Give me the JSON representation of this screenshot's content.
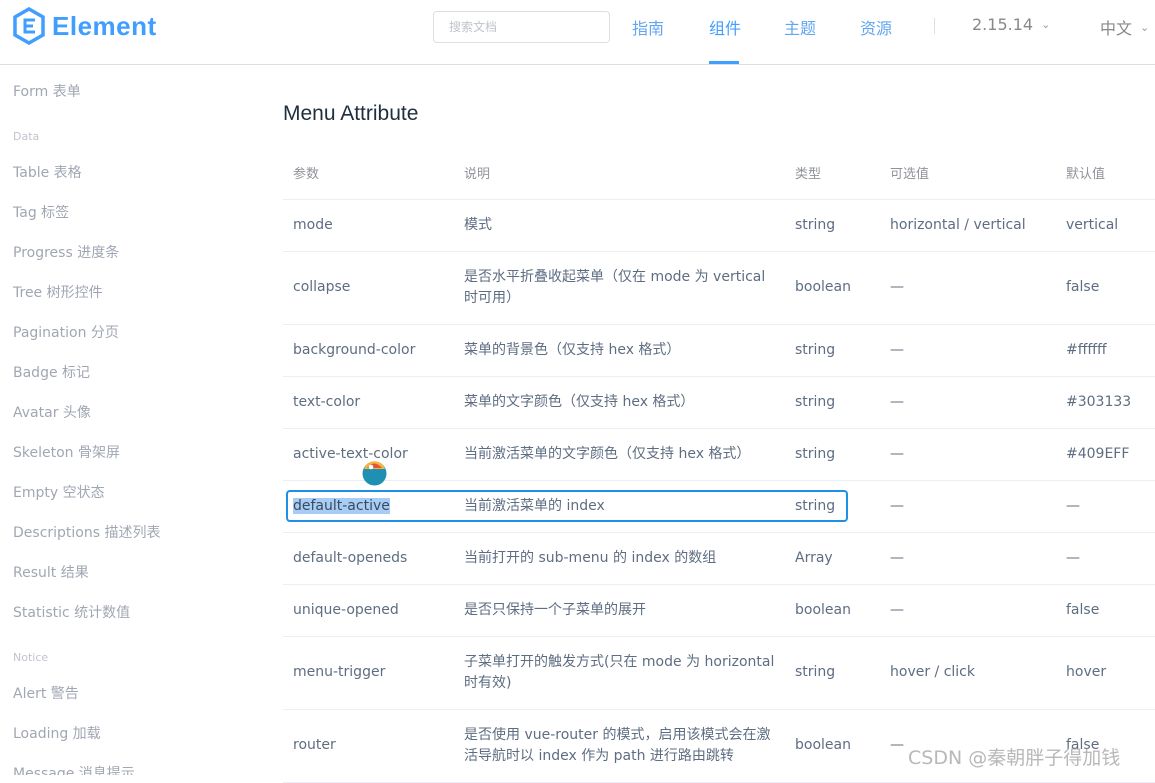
{
  "header": {
    "logo_text": "Element",
    "search_placeholder": "搜索文档",
    "nav": [
      {
        "label": "指南"
      },
      {
        "label": "组件"
      },
      {
        "label": "主题"
      },
      {
        "label": "资源"
      }
    ],
    "version": "2.15.14",
    "language": "中文"
  },
  "sidebar": {
    "items_top": [
      {
        "label": "Form 表单"
      }
    ],
    "group_data": "Data",
    "items_data": [
      {
        "label": "Table 表格"
      },
      {
        "label": "Tag 标签"
      },
      {
        "label": "Progress 进度条"
      },
      {
        "label": "Tree 树形控件"
      },
      {
        "label": "Pagination 分页"
      },
      {
        "label": "Badge 标记"
      },
      {
        "label": "Avatar 头像"
      },
      {
        "label": "Skeleton 骨架屏"
      },
      {
        "label": "Empty 空状态"
      },
      {
        "label": "Descriptions 描述列表"
      },
      {
        "label": "Result 结果"
      },
      {
        "label": "Statistic 统计数值"
      }
    ],
    "group_notice": "Notice",
    "items_notice": [
      {
        "label": "Alert 警告"
      },
      {
        "label": "Loading 加载"
      },
      {
        "label": "Message 消息提示"
      }
    ]
  },
  "main": {
    "title": "Menu Attribute",
    "columns": [
      "参数",
      "说明",
      "类型",
      "可选值",
      "默认值"
    ],
    "rows": [
      {
        "param": "mode",
        "desc": "模式",
        "type": "string",
        "options": "horizontal / vertical",
        "default": "vertical"
      },
      {
        "param": "collapse",
        "desc": "是否水平折叠收起菜单（仅在 mode 为 vertical 时可用）",
        "type": "boolean",
        "options": "—",
        "default": "false"
      },
      {
        "param": "background-color",
        "desc": "菜单的背景色（仅支持 hex 格式）",
        "type": "string",
        "options": "—",
        "default": "#ffffff"
      },
      {
        "param": "text-color",
        "desc": "菜单的文字颜色（仅支持 hex 格式）",
        "type": "string",
        "options": "—",
        "default": "#303133"
      },
      {
        "param": "active-text-color",
        "desc": "当前激活菜单的文字颜色（仅支持 hex 格式）",
        "type": "string",
        "options": "—",
        "default": "#409EFF"
      },
      {
        "param": "default-active",
        "desc": "当前激活菜单的 index",
        "type": "string",
        "options": "—",
        "default": "—"
      },
      {
        "param": "default-openeds",
        "desc": "当前打开的 sub-menu 的 index 的数组",
        "type": "Array",
        "options": "—",
        "default": "—"
      },
      {
        "param": "unique-opened",
        "desc": "是否只保持一个子菜单的展开",
        "type": "boolean",
        "options": "—",
        "default": "false"
      },
      {
        "param": "menu-trigger",
        "desc": "子菜单打开的触发方式(只在 mode 为 horizontal 时有效)",
        "type": "string",
        "options": "hover / click",
        "default": "hover"
      },
      {
        "param": "router",
        "desc": "是否使用 vue-router 的模式，启用该模式会在激活导航时以 index 作为 path 进行路由跳转",
        "type": "boolean",
        "options": "—",
        "default": "false"
      }
    ]
  },
  "watermark": "CSDN @秦朝胖子得加钱",
  "colors": {
    "brand": "#409eff",
    "selection": "#a8cdf5",
    "select_border": "#1e90e6"
  }
}
